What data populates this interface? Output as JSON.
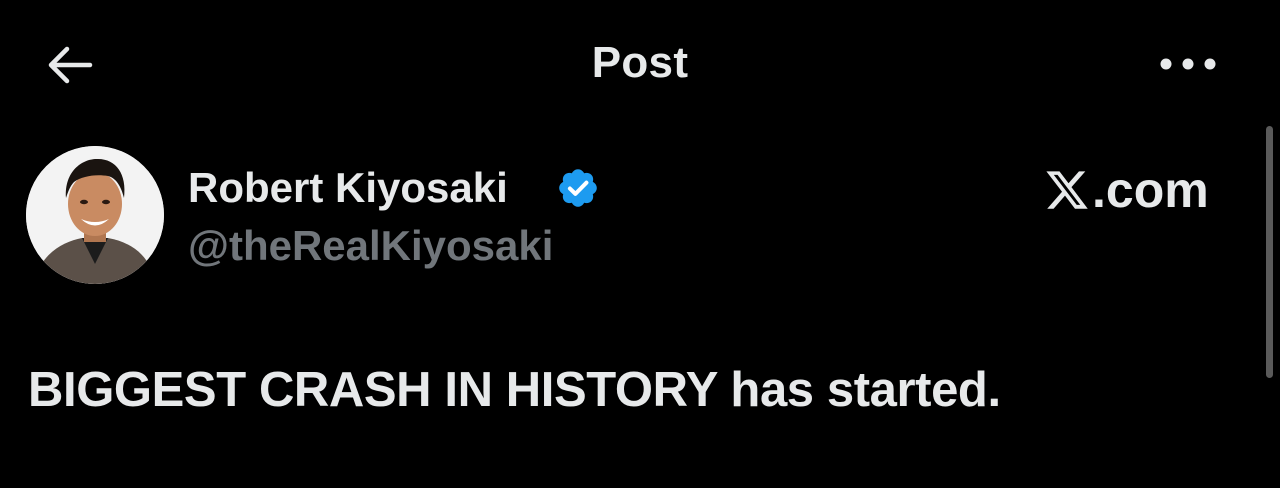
{
  "header": {
    "title": "Post",
    "back_icon": "arrow-left-icon",
    "more_icon": "more-horizontal-icon"
  },
  "post": {
    "author": {
      "name": "Robert Kiyosaki",
      "handle": "@theRealKiyosaki",
      "verified": true,
      "avatar": "avatar-photo"
    },
    "source": {
      "text": ".com",
      "icon": "x-logo-icon"
    },
    "text": "BIGGEST CRASH IN HISTORY has started."
  },
  "colors": {
    "background": "#000000",
    "primary_text": "#e7e9ea",
    "secondary_text": "#71767b",
    "verified_blue": "#1d9bf0",
    "scrollbar": "#5a5a5a"
  }
}
